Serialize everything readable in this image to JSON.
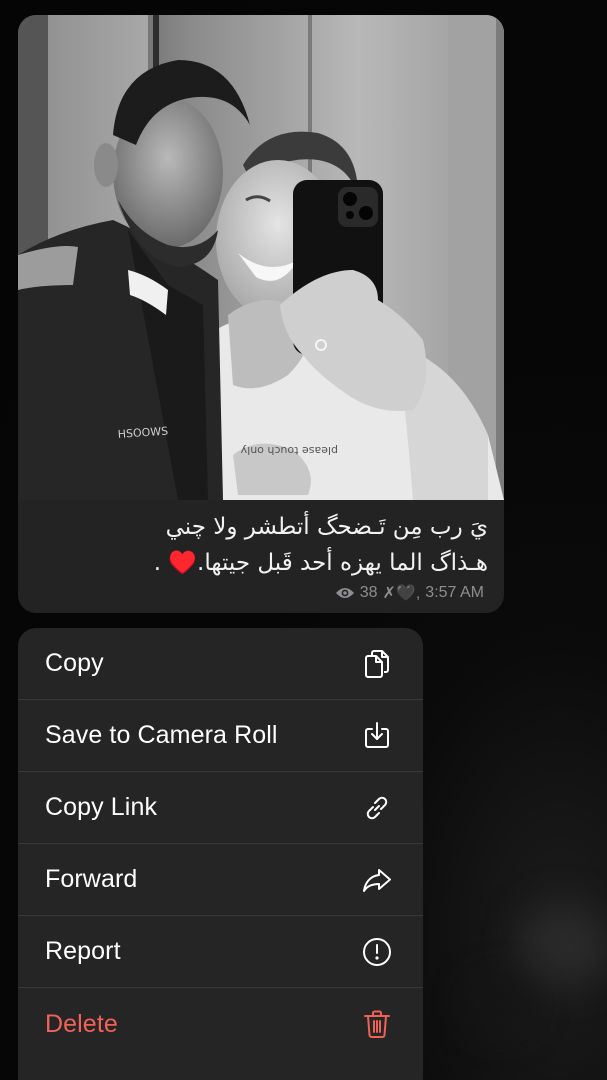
{
  "message": {
    "caption_lines": [
      "يَ رب مِن تَـضحگ أتطشر ولا چني",
      "هـذاگ الما يهزه أحد قَبل جيتها.♥️ ."
    ],
    "views": "38",
    "author": "✗🖤,",
    "time": "3:57 AM"
  },
  "menu": {
    "items": [
      {
        "label": "Copy",
        "icon": "copy-icon"
      },
      {
        "label": "Save to Camera Roll",
        "icon": "download-icon"
      },
      {
        "label": "Copy Link",
        "icon": "link-icon"
      },
      {
        "label": "Forward",
        "icon": "forward-icon"
      },
      {
        "label": "Report",
        "icon": "report-icon"
      },
      {
        "label": "Delete",
        "icon": "trash-icon"
      }
    ]
  },
  "colors": {
    "background": "#060606",
    "bubble": "#232324",
    "menu": "#252526",
    "delete": "#f06158",
    "meta": "#8d8d92"
  }
}
